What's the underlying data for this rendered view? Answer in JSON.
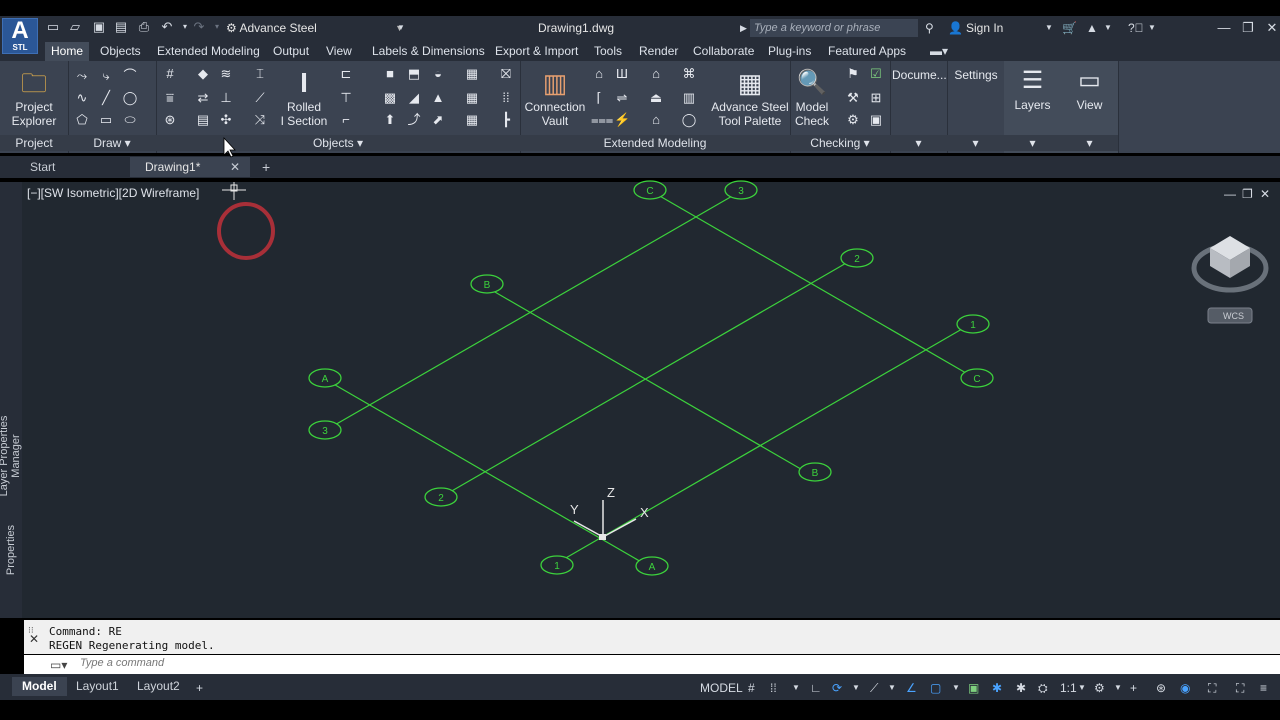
{
  "app": {
    "logo_letter": "A",
    "logo_sub": "STL",
    "workspace": "Advance Steel",
    "document_title": "Drawing1.dwg",
    "search_placeholder": "Type a keyword or phrase",
    "sign_in": "Sign In"
  },
  "ribbon_tabs": [
    {
      "label": "Home",
      "active": true
    },
    {
      "label": "Objects"
    },
    {
      "label": "Extended Modeling"
    },
    {
      "label": "Output"
    },
    {
      "label": "View"
    },
    {
      "label": "Labels & Dimensions"
    },
    {
      "label": "Export & Import"
    },
    {
      "label": "Tools"
    },
    {
      "label": "Render"
    },
    {
      "label": "Collaborate"
    },
    {
      "label": "Plug-ins"
    },
    {
      "label": "Featured Apps"
    }
  ],
  "ribbon": {
    "project_explorer": [
      "Project",
      "Explorer"
    ],
    "rolled_section": [
      "Rolled",
      "I Section"
    ],
    "connection_vault": [
      "Connection",
      "Vault"
    ],
    "tool_palette": [
      "Advance Steel",
      "Tool Palette"
    ],
    "model_check": [
      "Model",
      "Check"
    ],
    "documents": "Docume...",
    "settings": "Settings",
    "layers": "Layers",
    "view": "View",
    "panels": {
      "project": "Project",
      "draw": "Draw",
      "objects": "Objects",
      "extended_modeling": "Extended Modeling",
      "checking": "Checking"
    }
  },
  "doc_tabs": {
    "start": "Start",
    "drawing": "Drawing1*"
  },
  "viewport": {
    "label": "[−][SW Isometric][2D Wireframe]",
    "side_panels": [
      "Layer Properties Manager",
      "Properties"
    ],
    "viewcube_wcs": "WCS",
    "ucs": {
      "x": "X",
      "y": "Y",
      "z": "Z"
    }
  },
  "grid_bubbles": [
    {
      "label": "C"
    },
    {
      "label": "3"
    },
    {
      "label": "2"
    },
    {
      "label": "1"
    },
    {
      "label": "C"
    },
    {
      "label": "B"
    },
    {
      "label": "A"
    },
    {
      "label": "3"
    },
    {
      "label": "2"
    },
    {
      "label": "B"
    },
    {
      "label": "1"
    },
    {
      "label": "A"
    }
  ],
  "command": {
    "history": [
      "Command: RE",
      "REGEN Regenerating model."
    ],
    "placeholder": "Type a command"
  },
  "status": {
    "layouts": [
      {
        "label": "Model",
        "active": true
      },
      {
        "label": "Layout1"
      },
      {
        "label": "Layout2"
      }
    ],
    "model": "MODEL",
    "scale": "1:1"
  },
  "colors": {
    "grid_green": "#3cd23c",
    "viewport_bg": "#212830",
    "ribbon_bg": "#3b4351"
  }
}
